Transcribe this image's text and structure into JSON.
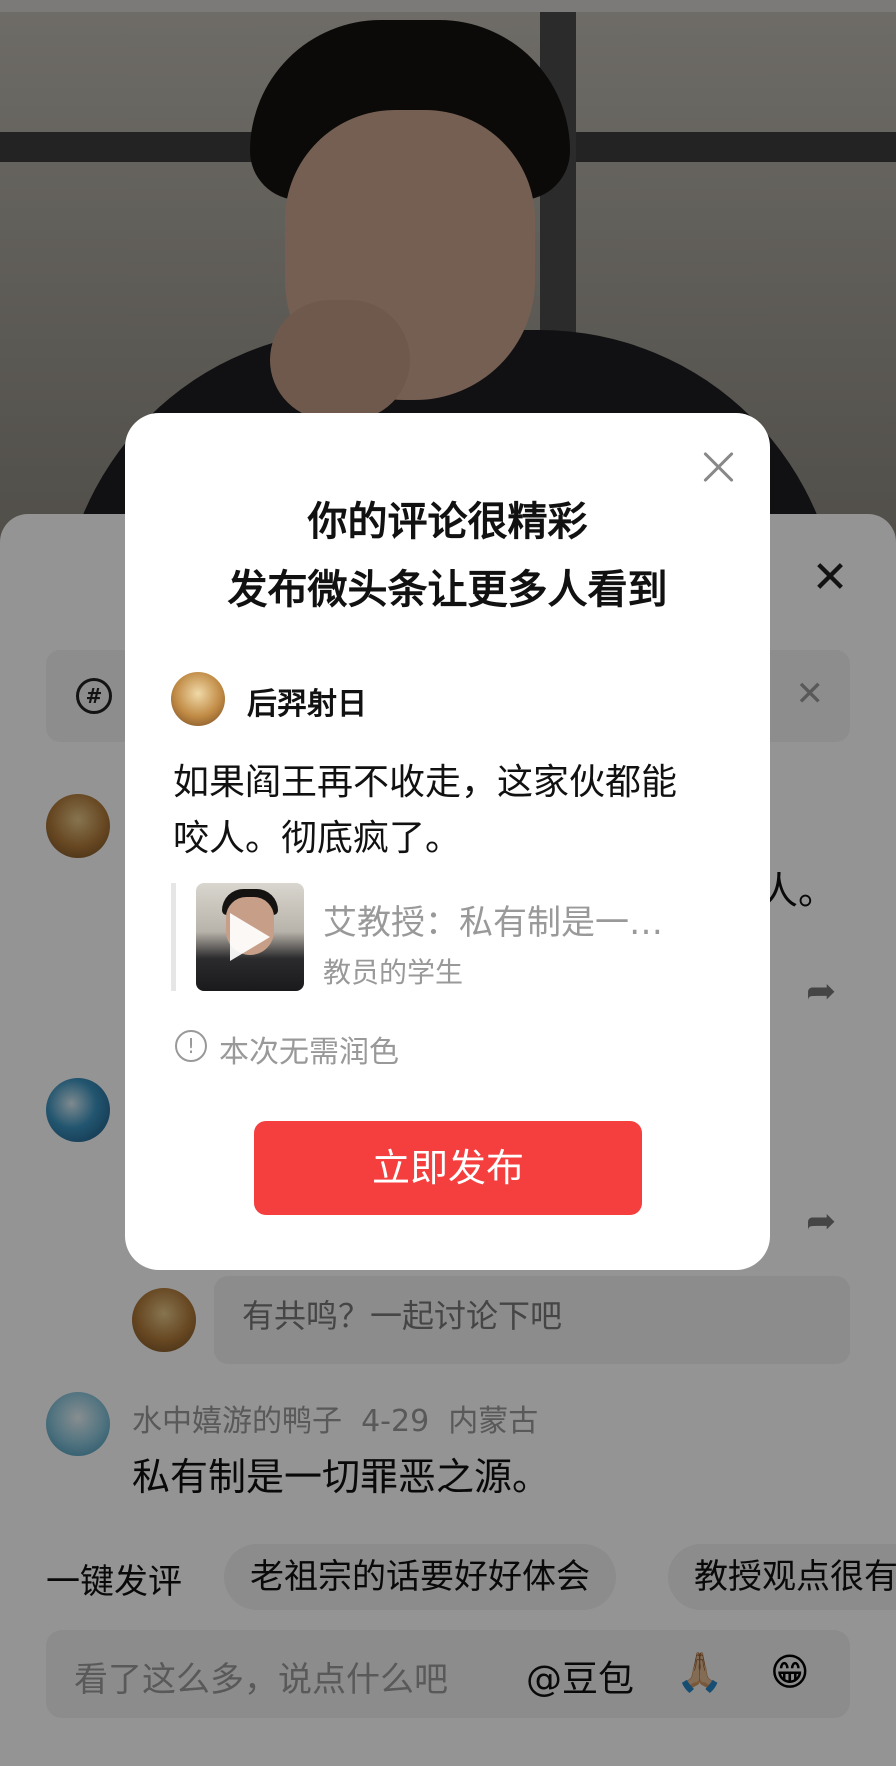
{
  "modal": {
    "title_line1": "你的评论很精彩",
    "title_line2": "发布微头条让更多人看到",
    "author_name": "后羿射日",
    "post_line1": "如果阎王再不收走，这家伙都能",
    "post_line2": "咬人。彻底疯了。",
    "quote_title": "艾教授：私有制是一…",
    "quote_subtitle": "教员的学生",
    "info_text": "本次无需润色",
    "publish_label": "立即发布"
  },
  "sheet": {
    "comment1_tail": "人。",
    "reply_placeholder": "有共鸣？一起讨论下吧",
    "comment3_user": "水中嬉游的鸭子",
    "comment3_date": "4-29",
    "comment3_location": "内蒙古",
    "comment3_text": "私有制是一切罪恶之源。"
  },
  "quick_reply": {
    "label": "一键发评",
    "chips": [
      "老祖宗的话要好好体会",
      "教授观点很有"
    ]
  },
  "input": {
    "placeholder": "看了这么多，说点什么吧",
    "mention": "@豆包",
    "emoji1": "🙏🏼",
    "emoji2": "😁"
  },
  "icons": {
    "topic": "#",
    "close": "✕",
    "info": "!"
  },
  "colors": {
    "publish_button": "#f53e3e"
  }
}
